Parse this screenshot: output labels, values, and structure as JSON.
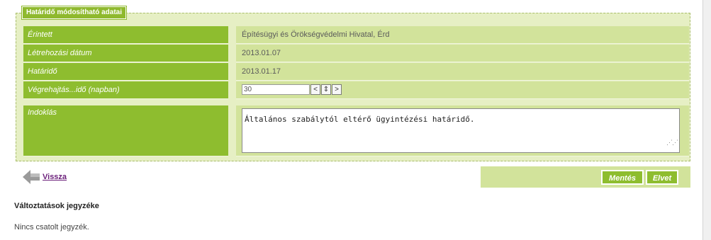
{
  "fieldset": {
    "legend": "Határidő módosítható adatai",
    "rows": [
      {
        "label": "Érintett",
        "value": "Építésügyi és Örökségvédelmi Hivatal, Érd"
      },
      {
        "label": "Létrehozási dátum",
        "value": "2013.01.07"
      },
      {
        "label": "Határidő",
        "value": "2013.01.17"
      },
      {
        "label": "Végrehajtás...idő (napban)",
        "value": "30"
      },
      {
        "label": "Indoklás",
        "value": "Általános szabálytól eltérő ügyintézési határidő."
      }
    ],
    "spinner": {
      "prev": "<",
      "mid": "⇕",
      "next": ">"
    }
  },
  "back": {
    "label": "Vissza"
  },
  "actions": {
    "save": "Mentés",
    "discard": "Elvet"
  },
  "changes": {
    "title": "Változtatások jegyzéke",
    "empty": "Nincs csatolt jegyzék."
  },
  "colors": {
    "accent": "#8ebd2f",
    "panel": "#e6efc4",
    "value_bg": "#d2e39b",
    "link": "#6b1f7a"
  }
}
